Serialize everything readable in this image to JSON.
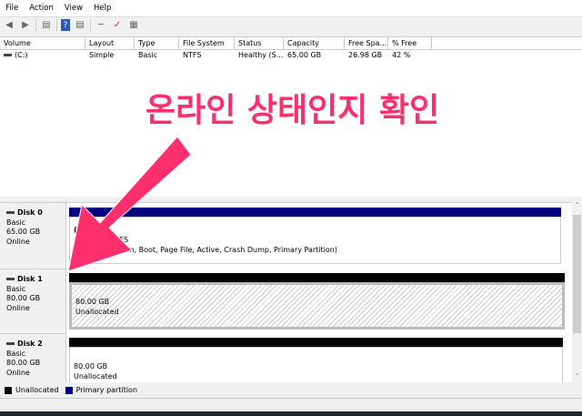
{
  "menu": [
    "File",
    "Action",
    "View",
    "Help"
  ],
  "toolbar": {
    "icons": [
      "back-icon",
      "forward-icon",
      "console-tree-icon",
      "help-icon",
      "properties-icon",
      "connect-icon",
      "checklist-icon",
      "settings-icon"
    ]
  },
  "volume_list": {
    "headers": [
      "Volume",
      "Layout",
      "Type",
      "File System",
      "Status",
      "Capacity",
      "Free Spa...",
      "% Free"
    ],
    "rows": [
      [
        "(C:)",
        "Simple",
        "Basic",
        "NTFS",
        "Healthy (S...",
        "65.00 GB",
        "26.98 GB",
        "42 %"
      ]
    ]
  },
  "disks": [
    {
      "name": "Disk 0",
      "type": "Basic",
      "size": "65.00 GB",
      "state": "Online",
      "part_title": "(C:)",
      "part_size": "65.00 GB NTFS",
      "part_status": "Healthy (System, Boot, Page File, Active, Crash Dump, Primary Partition)",
      "bar_color": "#00007f"
    },
    {
      "name": "Disk 1",
      "type": "Basic",
      "size": "80.00 GB",
      "state": "Online",
      "part_size": "80.00 GB",
      "part_status": "Unallocated",
      "bar_color": "#000000"
    },
    {
      "name": "Disk 2",
      "type": "Basic",
      "size": "80.00 GB",
      "state": "Online",
      "part_size": "80.00 GB",
      "part_status": "Unallocated",
      "bar_color": "#000000"
    }
  ],
  "legend": [
    {
      "label": "Unallocated",
      "color": "#000000"
    },
    {
      "label": "Primary partition",
      "color": "#00007f"
    }
  ],
  "annotation": {
    "text": "온라인 상태인지 확인",
    "color": "#ff2f6e"
  }
}
